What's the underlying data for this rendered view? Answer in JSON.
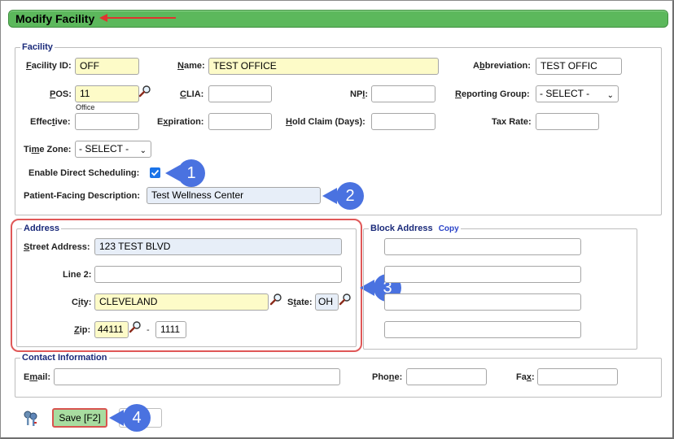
{
  "window": {
    "title": "Modify Facility"
  },
  "facility": {
    "legend": "Facility",
    "facility_id": {
      "label": "Facility ID:",
      "value": "OFF"
    },
    "name": {
      "label": "Name:",
      "value": "TEST OFFICE"
    },
    "abbreviation": {
      "label": "Abbreviation:",
      "value": "TEST OFFIC"
    },
    "pos": {
      "label": "POS:",
      "value": "11",
      "hint": "Office"
    },
    "clia": {
      "label": "CLIA:",
      "value": ""
    },
    "npi": {
      "label": "NPI:",
      "value": ""
    },
    "reporting_group": {
      "label": "Reporting Group:",
      "value": "- SELECT -"
    },
    "effective": {
      "label": "Effective:",
      "value": ""
    },
    "expiration": {
      "label": "Expiration:",
      "value": ""
    },
    "hold_claim": {
      "label": "Hold Claim (Days):",
      "value": ""
    },
    "tax_rate": {
      "label": "Tax Rate:",
      "value": ""
    },
    "time_zone": {
      "label": "Time Zone:",
      "value": "- SELECT -"
    },
    "enable_direct_scheduling": {
      "label": "Enable Direct Scheduling:",
      "checked": true
    },
    "patient_facing_description": {
      "label": "Patient-Facing Description:",
      "value": "Test Wellness Center"
    }
  },
  "address": {
    "legend": "Address",
    "street": {
      "label": "Street Address:",
      "value": "123 TEST BLVD"
    },
    "line2": {
      "label": "Line 2:",
      "value": ""
    },
    "city": {
      "label": "City:",
      "value": "CLEVELAND"
    },
    "state": {
      "label": "State:",
      "value": "OH"
    },
    "zip": {
      "label": "Zip:",
      "value": "44111",
      "separator": "-",
      "ext": "1111"
    }
  },
  "block_address": {
    "legend": "Block Address",
    "copy_link": "Copy"
  },
  "contact": {
    "legend": "Contact Information",
    "email": {
      "label": "Email:",
      "value": ""
    },
    "phone": {
      "label": "Phone:",
      "value": ""
    },
    "fax": {
      "label": "Fax:",
      "value": ""
    }
  },
  "footer": {
    "save_label": "Save [F2]"
  },
  "callouts": [
    "1",
    "2",
    "3",
    "4"
  ],
  "colors": {
    "title_bar": "#5cb85c",
    "callout": "#4a72e0",
    "highlight": "#e05858",
    "required_field": "#fdfbc8"
  },
  "icons": [
    "magnifier-icon",
    "keys-icon",
    "check-icon"
  ]
}
